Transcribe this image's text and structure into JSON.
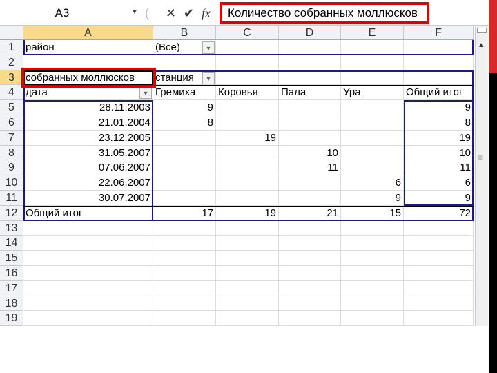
{
  "formula_bar": {
    "name_box": "A3",
    "cancel_icon": "✕",
    "enter_icon": "✔",
    "fx_label": "fx",
    "formula": "Количество собранных моллюсков"
  },
  "columns": [
    "A",
    "B",
    "C",
    "D",
    "E",
    "F"
  ],
  "rows": [
    "1",
    "2",
    "3",
    "4",
    "5",
    "6",
    "7",
    "8",
    "9",
    "10",
    "11",
    "12",
    "13",
    "14",
    "15",
    "16",
    "17",
    "18",
    "19"
  ],
  "selected_cell": "A3",
  "cells": {
    "A1": "район",
    "B1": "(Все)",
    "A3": "собранных моллюсков",
    "B3": "станция",
    "A4": "дата",
    "B4": "Гремиха",
    "C4": "Коровья",
    "D4": "Пала",
    "E4": "Ура",
    "F4": "Общий итог",
    "A5": "28.11.2003",
    "B5": "9",
    "F5": "9",
    "A6": "21.01.2004",
    "B6": "8",
    "F6": "8",
    "A7": "23.12.2005",
    "C7": "19",
    "F7": "19",
    "A8": "31.05.2007",
    "D8": "10",
    "F8": "10",
    "A9": "07.06.2007",
    "D9": "11",
    "F9": "11",
    "A10": "22.06.2007",
    "E10": "6",
    "F10": "6",
    "A11": "30.07.2007",
    "E11": "9",
    "F11": "9",
    "A12": "Общий итог",
    "B12": "17",
    "C12": "19",
    "D12": "21",
    "E12": "15",
    "F12": "72"
  },
  "dropdown_cells": [
    "B1",
    "B3",
    "A4"
  ],
  "colors": {
    "highlight_box": "#e00000",
    "pivot_border": "#1a1a8c",
    "selected_header": "#f9d98b"
  }
}
